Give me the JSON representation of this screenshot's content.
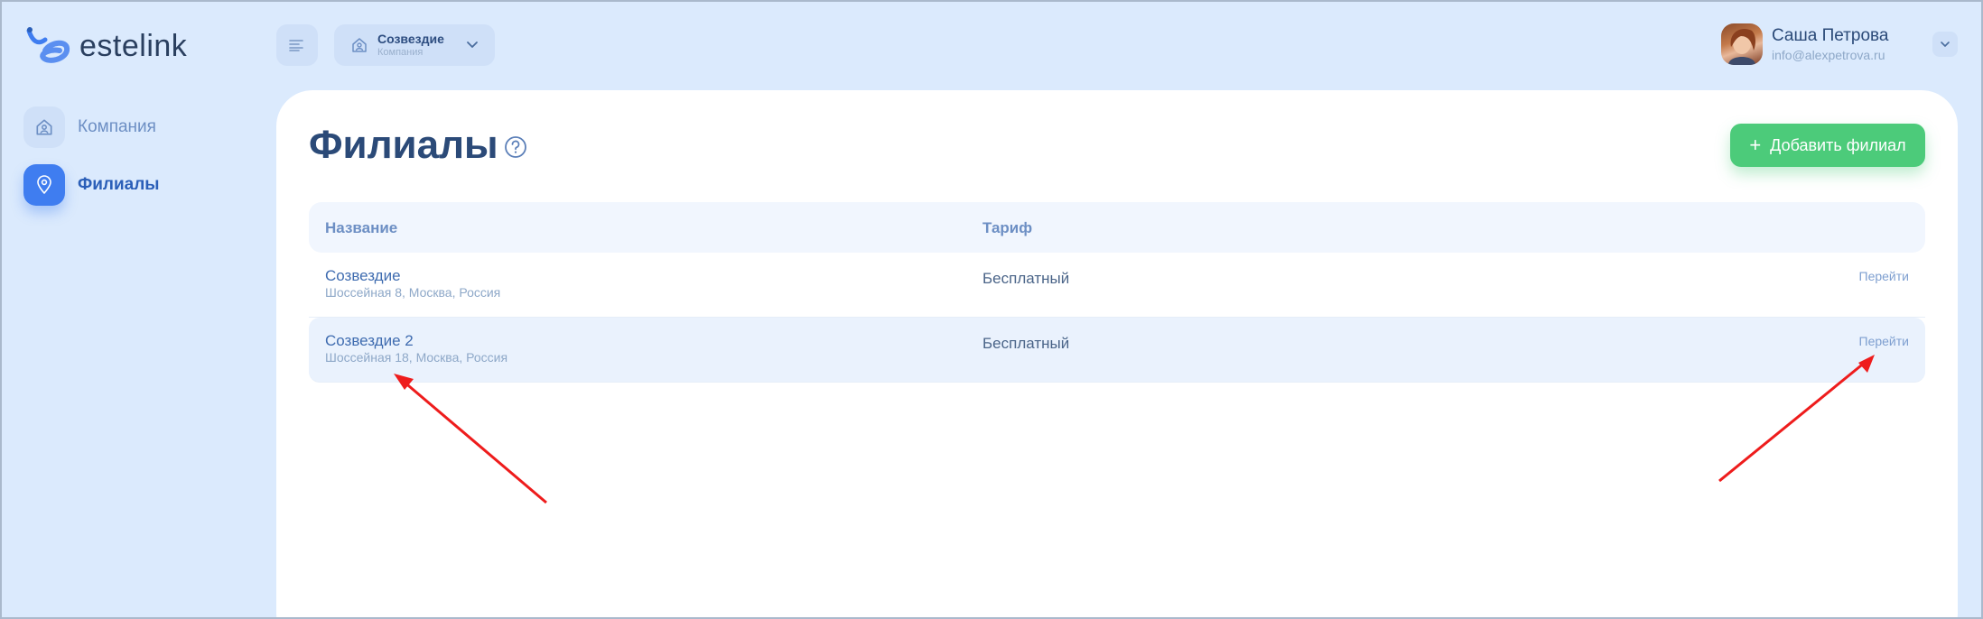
{
  "brand": {
    "name": "estelink"
  },
  "topbar": {
    "company": {
      "name": "Созвездие",
      "subtitle": "Компания"
    },
    "user": {
      "name": "Саша Петрова",
      "email": "info@alexpetrova.ru"
    }
  },
  "sidebar": {
    "items": [
      {
        "label": "Компания",
        "icon": "company-icon",
        "active": false
      },
      {
        "label": "Филиалы",
        "icon": "location-pin-icon",
        "active": true
      }
    ]
  },
  "main": {
    "title": "Филиалы",
    "add_button": "Добавить филиал",
    "table": {
      "headers": {
        "name": "Название",
        "tariff": "Тариф"
      },
      "rows": [
        {
          "name": "Созвездие",
          "address": "Шоссейная 8, Москва, Россия",
          "tariff": "Бесплатный",
          "action": "Перейти"
        },
        {
          "name": "Созвездие 2",
          "address": "Шоссейная 18, Москва, Россия",
          "tariff": "Бесплатный",
          "action": "Перейти"
        }
      ]
    }
  },
  "colors": {
    "background": "#dbeafd",
    "accent": "#3f7df0",
    "success": "#4ccb7a",
    "annotation": "#ee1c1c"
  }
}
